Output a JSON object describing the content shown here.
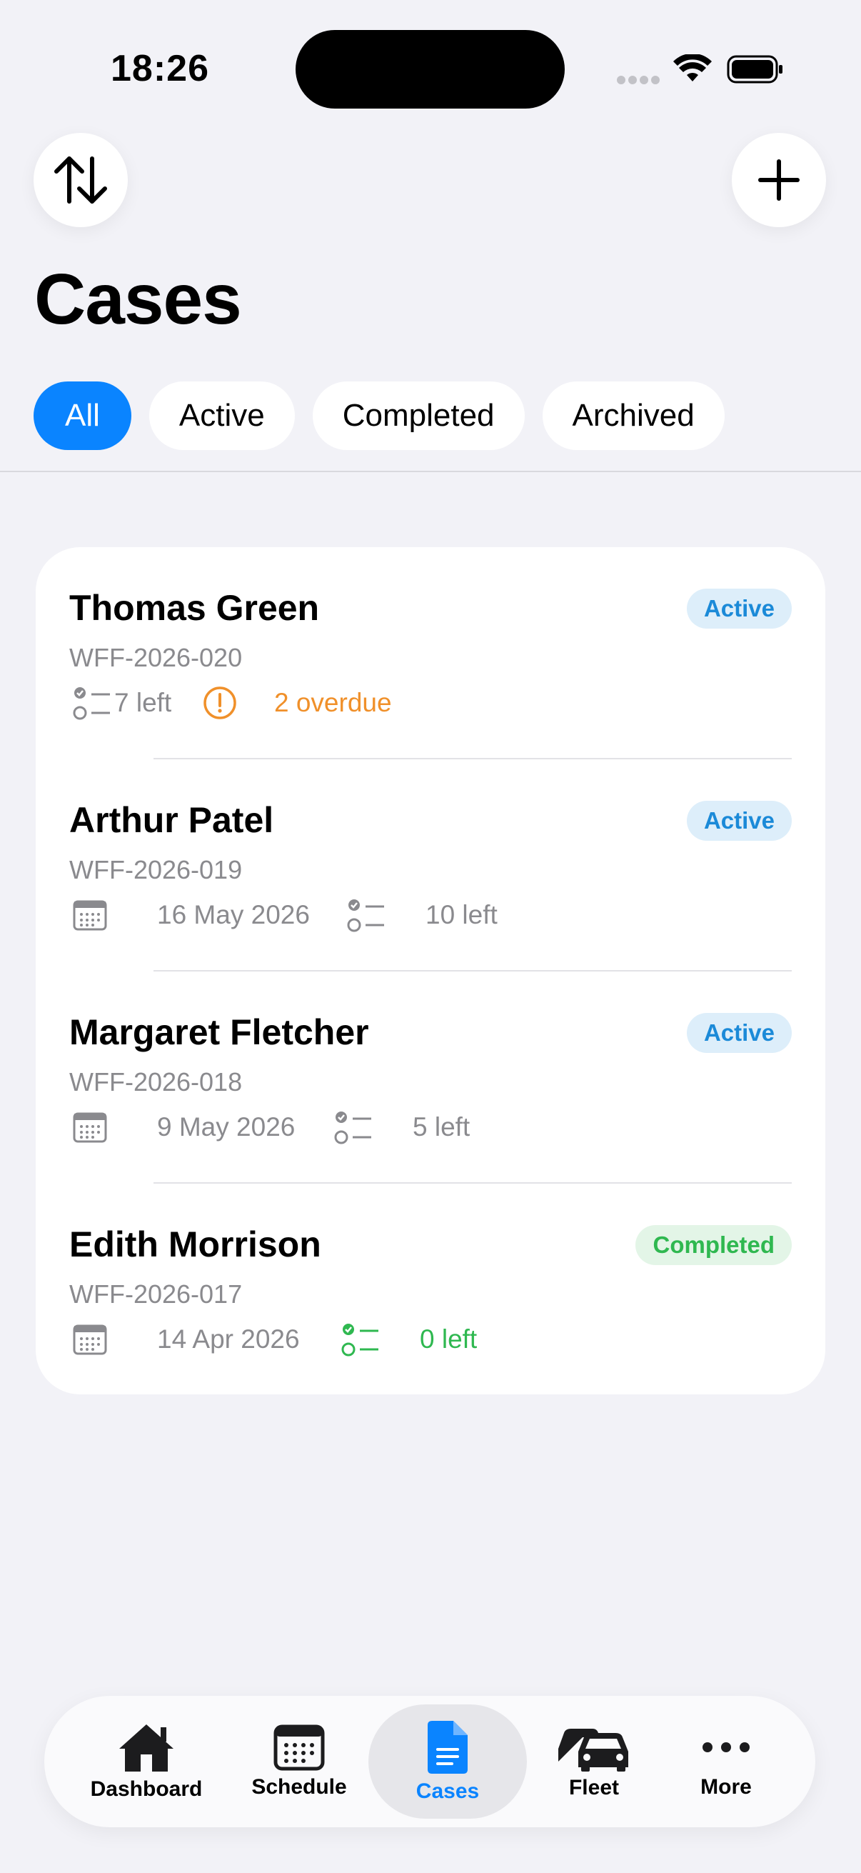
{
  "status_bar": {
    "time": "18:26"
  },
  "header": {
    "title": "Cases",
    "sort_button_icon": "arrow-up-down-icon",
    "add_button_icon": "plus-icon"
  },
  "filters": [
    {
      "label": "All",
      "selected": true
    },
    {
      "label": "Active",
      "selected": false
    },
    {
      "label": "Completed",
      "selected": false
    },
    {
      "label": "Archived",
      "selected": false
    }
  ],
  "cases": [
    {
      "name": "Thomas Green",
      "case_id": "WFF-2026-020",
      "status": "Active",
      "tasks_left": "7 left",
      "overdue": "2 overdue",
      "date": null
    },
    {
      "name": "Arthur Patel",
      "case_id": "WFF-2026-019",
      "status": "Active",
      "date": "16 May 2026",
      "tasks_left": "10 left"
    },
    {
      "name": "Margaret Fletcher",
      "case_id": "WFF-2026-018",
      "status": "Active",
      "date": "9 May 2026",
      "tasks_left": "5 left"
    },
    {
      "name": "Edith Morrison",
      "case_id": "WFF-2026-017",
      "status": "Completed",
      "date": "14 Apr 2026",
      "tasks_left": "0 left"
    }
  ],
  "tab_bar": [
    {
      "label": "Dashboard",
      "icon": "house-icon"
    },
    {
      "label": "Schedule",
      "icon": "calendar-icon"
    },
    {
      "label": "Cases",
      "icon": "document-icon",
      "selected": true
    },
    {
      "label": "Fleet",
      "icon": "cars-icon"
    },
    {
      "label": "More",
      "icon": "ellipsis-icon"
    }
  ],
  "colors": {
    "accent": "#0a84ff",
    "active_badge_text": "#1b8ad8",
    "active_badge_bg": "#ddeefa",
    "completed_green": "#2fb850",
    "overdue_orange": "#f0902a",
    "background": "#f2f2f7"
  }
}
